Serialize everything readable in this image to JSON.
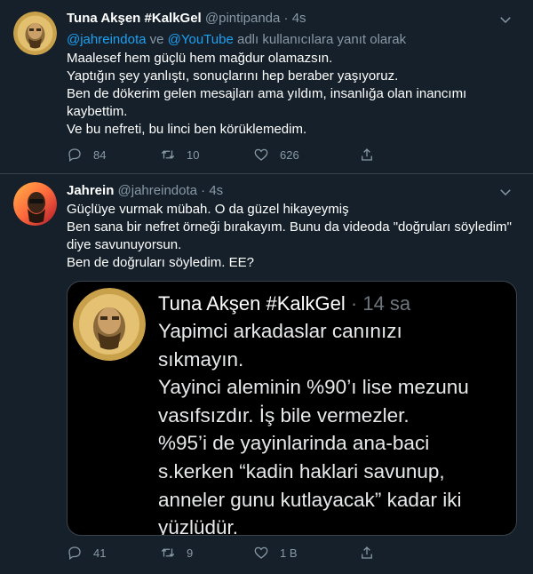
{
  "tweet1": {
    "name": "Tuna Akşen #KalkGel",
    "handle": "@pintipanda",
    "dot": "·",
    "time": "4s",
    "reply": {
      "mention1": "@jahreindota",
      "conj": "ve",
      "mention2": "@YouTube",
      "suffix": "adlı kullanıcılara yanıt olarak"
    },
    "lines": [
      "Maalesef hem güçlü hem mağdur olamazsın.",
      "Yaptığın şey yanlıştı, sonuçlarını hep beraber yaşıyoruz.",
      "Ben de dökerim gelen mesajları ama yıldım, insanlığa olan inancımı",
      "kaybettim.",
      "Ve bu nefreti, bu linci ben körüklemedim."
    ],
    "actions": {
      "replies": "84",
      "retweets": "10",
      "likes": "626"
    }
  },
  "tweet2": {
    "name": "Jahrein",
    "handle": "@jahreindota",
    "dot": "·",
    "time": "4s",
    "lines": [
      "Güçlüye vurmak mübah. O da güzel hikayeymiş",
      "Ben sana bir nefret örneği bırakayım. Bunu da videoda \"doğruları söyledim\"",
      "diye savunuyorsun.",
      "Ben de doğruları söyledim. EE?"
    ],
    "quoted": {
      "name": "Tuna Akşen #KalkGel",
      "meta": "· 14 sa",
      "lines": [
        "Yapimci arkadaslar canınızı",
        "sıkmayın.",
        "Yayinci aleminin %90’ı lise mezunu",
        "vasıfsızdır. İş bile vermezler.",
        "%95’i de yayinlarinda ana-baci",
        "s.kerken “kadin haklari savunup,",
        "anneler gunu kutlayacak” kadar iki",
        "yüzlüdür."
      ]
    },
    "actions": {
      "replies": "41",
      "retweets": "9",
      "likes": "1 B"
    }
  },
  "colors": {
    "background": "#15202b",
    "secondary_text": "#8899a6",
    "link": "#1da1f2",
    "border": "#38444d"
  }
}
